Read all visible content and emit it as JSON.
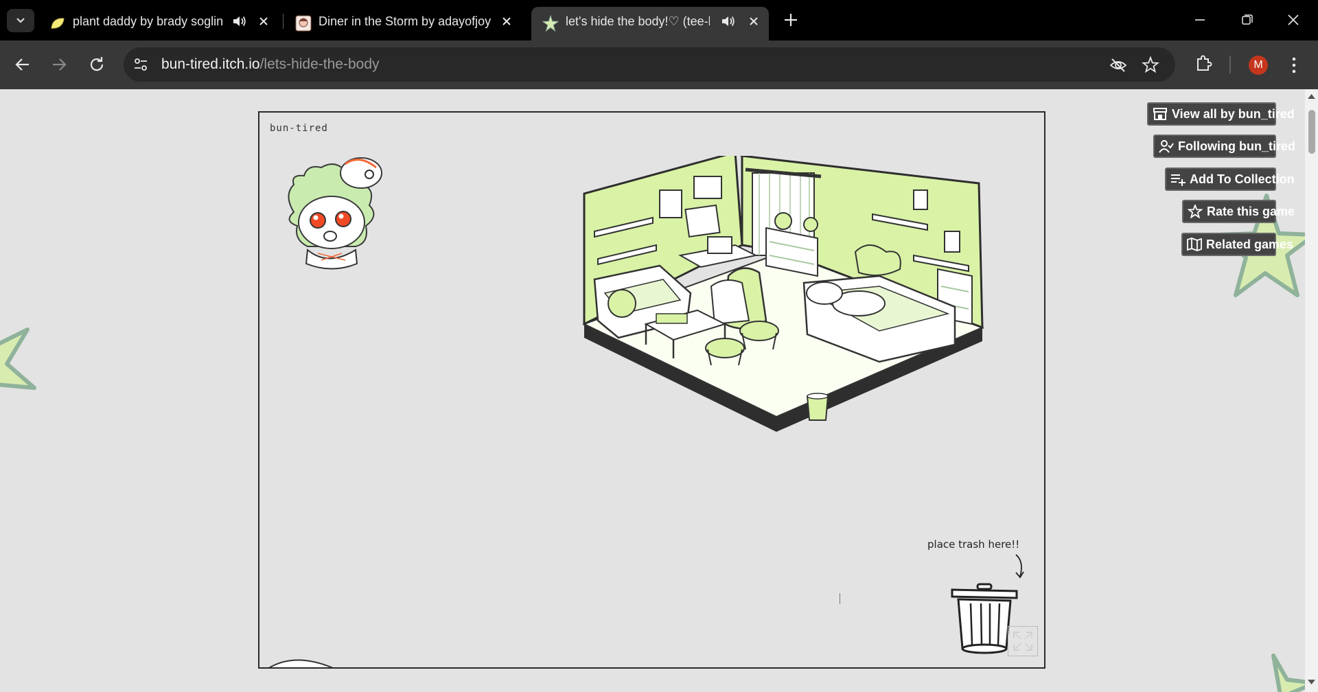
{
  "tabs": [
    {
      "title": "plant daddy by brady soglin",
      "audio": true,
      "active": false,
      "favicon": "leaf-icon"
    },
    {
      "title": "Diner in the Storm by adayofjoy",
      "audio": false,
      "active": false,
      "favicon": "diner-portrait-icon"
    },
    {
      "title": "let's hide the body!♡ (tee-hee)",
      "audio": true,
      "active": true,
      "favicon": "star-icon"
    }
  ],
  "url": {
    "host": "bun-tired.itch.io",
    "path": "/lets-hide-the-body"
  },
  "profile_initial": "M",
  "game": {
    "studio_label": "bun-tired",
    "trash_hint": "place trash here!!"
  },
  "itch_buttons": {
    "view_all": "View all by bun_tired",
    "following": "Following bun_tired",
    "add_collection": "Add To Collection",
    "rate": "Rate this game",
    "related": "Related games"
  },
  "colors": {
    "room_accent": "#d9f2a6",
    "star_fill": "#d8ecb0",
    "star_stroke": "#8fb29a",
    "avatar": "#c5361d",
    "button_bg": "#444444"
  }
}
